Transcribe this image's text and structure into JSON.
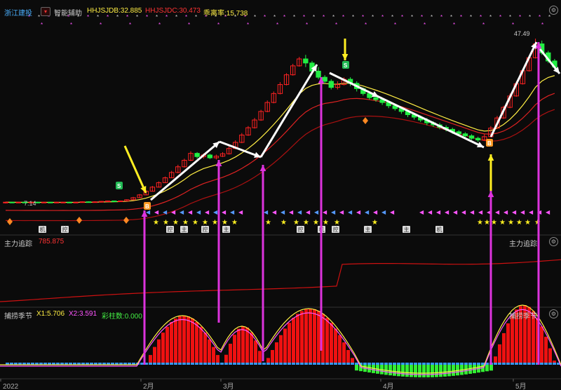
{
  "header": {
    "stock_name": "浙江建投",
    "indicator_name": "智能辅助",
    "ind1": "HHJSJDB:32.885",
    "ind2": "HHJSJDC:30.473",
    "ind3": "乖离率:15.738"
  },
  "panel2": {
    "title": "主力追踪",
    "value": "785.875",
    "right_label": "主力追踪"
  },
  "panel3": {
    "title": "捕捞季节",
    "x1": "X1:5.706",
    "x2": "X2:3.591",
    "bars": "彩柱数:0.000",
    "right_label": "捕捞季节"
  },
  "annotations": {
    "left_price": "7.14",
    "high_price": "47.49",
    "signal_b": "B",
    "signal_s": "S",
    "marker_labels": [
      "机",
      "控",
      "控",
      "主",
      "控",
      "主",
      "控",
      "机",
      "控",
      "主",
      "主",
      "机"
    ]
  },
  "colors": {
    "up": "#ff2222",
    "down": "#22ee44",
    "ma_yellow": "#ffee44",
    "ma_red": "#dd2222",
    "arrow_white": "#ffffff",
    "arrow_magenta": "#dd33dd",
    "bg": "#0b0b0b"
  },
  "chart_data": {
    "type": "candlestick",
    "x_axis_labels": [
      "2022",
      "2月",
      "3月",
      "4月",
      "5月"
    ],
    "price_range_shown": [
      7.14,
      47.49
    ],
    "series": [
      {
        "name": "HHJSJDB",
        "last_value": 32.885
      },
      {
        "name": "HHJSJDC",
        "last_value": 30.473
      },
      {
        "name": "X1",
        "last_value": 5.706
      },
      {
        "name": "X2",
        "last_value": 3.591
      }
    ]
  }
}
